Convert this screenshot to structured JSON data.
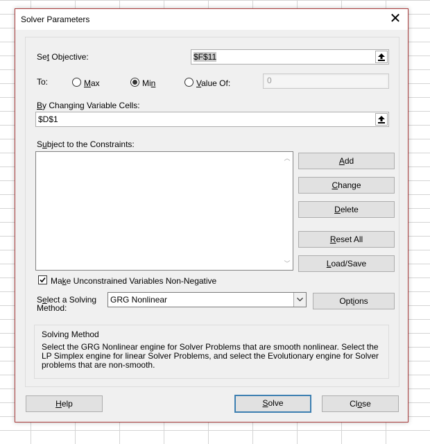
{
  "dialog": {
    "title": "Solver Parameters",
    "close_label": "✕"
  },
  "objective": {
    "label": "Set Objective:",
    "value": "$F$11"
  },
  "to": {
    "label": "To:",
    "options": [
      {
        "label": "Max",
        "checked": false
      },
      {
        "label": "Min",
        "checked": true
      },
      {
        "label": "Value Of:",
        "checked": false
      }
    ],
    "value_of": "0"
  },
  "variable_cells": {
    "label": "By Changing Variable Cells:",
    "value": "$D$1"
  },
  "constraints": {
    "label": "Subject to the Constraints:",
    "items": []
  },
  "buttons": {
    "add": "Add",
    "change": "Change",
    "delete": "Delete",
    "reset_all": "Reset All",
    "load_save": "Load/Save",
    "options": "Options",
    "help": "Help",
    "solve": "Solve",
    "close": "Close"
  },
  "non_negative": {
    "label": "Make Unconstrained Variables Non-Negative",
    "checked": true
  },
  "method": {
    "label_line1": "Select a Solving",
    "label_line2": "Method:",
    "selected": "GRG Nonlinear"
  },
  "solving_method": {
    "title": "Solving Method",
    "description": "Select the GRG Nonlinear engine for Solver Problems that are smooth nonlinear. Select the LP Simplex engine for linear Solver Problems, and select the Evolutionary engine for Solver problems that are non-smooth."
  },
  "colors": {
    "dialog_border": "#a83a3a",
    "default_button_border": "#3c7fb1"
  }
}
